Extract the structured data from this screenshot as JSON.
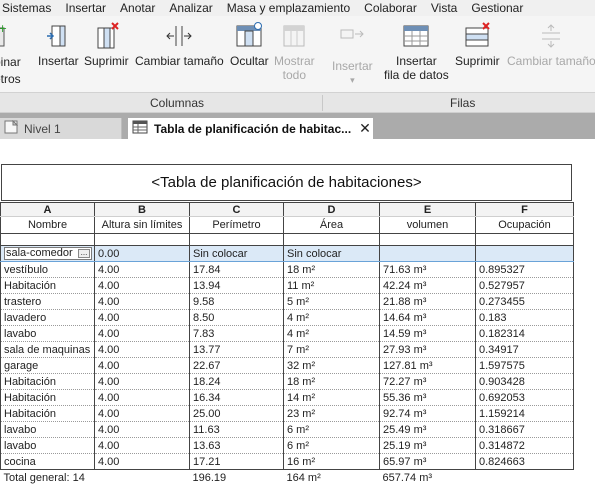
{
  "menu": [
    "Sistemas",
    "Insertar",
    "Anotar",
    "Analizar",
    "Masa y emplazamiento",
    "Colaborar",
    "Vista",
    "Gestionar"
  ],
  "ribbon": {
    "partial_left_label": "binar\netros",
    "columnas": [
      {
        "label": "Insertar",
        "icon": "insert-column-icon"
      },
      {
        "label": "Suprimir",
        "icon": "delete-column-icon"
      },
      {
        "label": "Cambiar tamaño",
        "icon": "resize-column-icon"
      },
      {
        "label": "Ocultar",
        "icon": "hide-column-icon"
      },
      {
        "label": "Mostrar\ntodo",
        "icon": "unhide-all-icon",
        "disabled": true
      }
    ],
    "filas": [
      {
        "label": "Insertar",
        "icon": "insert-row-icon",
        "disabled": true,
        "dropdown": "▾"
      },
      {
        "label": "Insertar\nfila de datos",
        "icon": "insert-data-row-icon"
      },
      {
        "label": "Suprimir",
        "icon": "delete-row-icon"
      },
      {
        "label": "Cambiar tamaño",
        "icon": "resize-row-icon",
        "disabled": true
      }
    ],
    "panel_columnas": "Columnas",
    "panel_filas": "Filas"
  },
  "tabs": [
    {
      "label": "Nivel 1",
      "icon": "floor-plan-icon"
    },
    {
      "label": "Tabla de planificación de habitac...",
      "icon": "schedule-icon",
      "close": "✕"
    }
  ],
  "schedule": {
    "title": "<Tabla de planificación de habitaciones>",
    "letters": [
      "A",
      "B",
      "C",
      "D",
      "E",
      "F"
    ],
    "headers": [
      "Nombre",
      "Altura sin límites",
      "Perímetro",
      "Área",
      "volumen",
      "Ocupación"
    ],
    "rows": [
      [
        "sala-comedor",
        "0.00",
        "Sin colocar",
        "Sin colocar",
        "",
        ""
      ],
      [
        "vestíbulo",
        "4.00",
        "17.84",
        "18 m²",
        "71.63 m³",
        "0.895327"
      ],
      [
        "Habitación",
        "4.00",
        "13.94",
        "11 m²",
        "42.24 m³",
        "0.527957"
      ],
      [
        "trastero",
        "4.00",
        "9.58",
        "5 m²",
        "21.88 m³",
        "0.273455"
      ],
      [
        "lavadero",
        "4.00",
        "8.50",
        "4 m²",
        "14.64 m³",
        "0.183"
      ],
      [
        "lavabo",
        "4.00",
        "7.83",
        "4 m²",
        "14.59 m³",
        "0.182314"
      ],
      [
        "sala de maquinas",
        "4.00",
        "13.77",
        "7 m²",
        "27.93 m³",
        "0.34917"
      ],
      [
        "garage",
        "4.00",
        "22.67",
        "32 m²",
        "127.81 m³",
        "1.597575"
      ],
      [
        "Habitación",
        "4.00",
        "18.24",
        "18 m²",
        "72.27 m³",
        "0.903428"
      ],
      [
        "Habitación",
        "4.00",
        "16.34",
        "14 m²",
        "55.36 m³",
        "0.692053"
      ],
      [
        "Habitación",
        "4.00",
        "25.00",
        "23 m²",
        "92.74 m³",
        "1.159214"
      ],
      [
        "lavabo",
        "4.00",
        "11.63",
        "6 m²",
        "25.49 m³",
        "0.318667"
      ],
      [
        "lavabo",
        "4.00",
        "13.63",
        "6 m²",
        "25.19 m³",
        "0.314872"
      ],
      [
        "cocina",
        "4.00",
        "17.21",
        "16 m²",
        "65.97 m³",
        "0.824663"
      ]
    ],
    "total": [
      "Total general: 14",
      "",
      "196.19",
      "164 m²",
      "657.74 m³",
      ""
    ],
    "selected_cell_button": "..."
  }
}
